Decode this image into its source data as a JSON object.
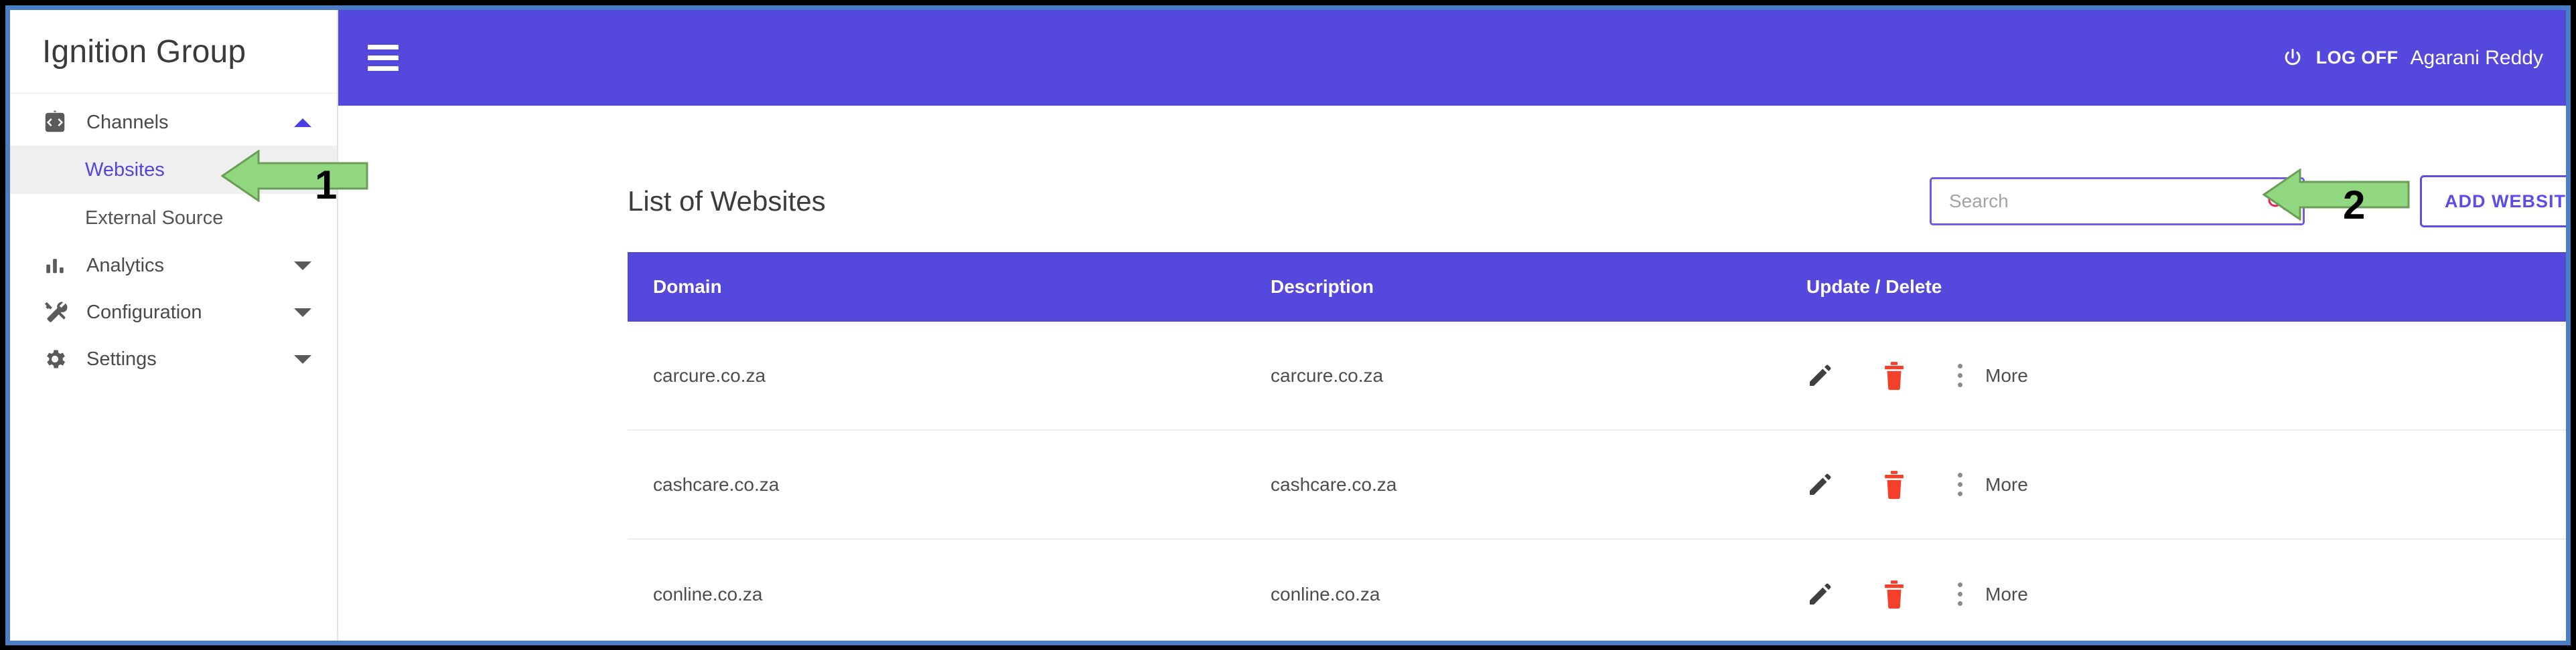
{
  "brand": {
    "title": "Ignition Group"
  },
  "sidebar": {
    "groups": [
      {
        "label": "Channels",
        "icon": "channels-icon",
        "expanded": true,
        "caret": "up"
      },
      {
        "label": "Analytics",
        "icon": "analytics-icon",
        "expanded": false,
        "caret": "down"
      },
      {
        "label": "Configuration",
        "icon": "configuration-icon",
        "expanded": false,
        "caret": "down"
      },
      {
        "label": "Settings",
        "icon": "settings-icon",
        "expanded": false,
        "caret": "down"
      }
    ],
    "channels_items": [
      {
        "label": "Websites",
        "active": true
      },
      {
        "label": "External Source",
        "active": false
      }
    ]
  },
  "topbar": {
    "menu_icon": "hamburger-icon",
    "power_icon": "power-icon",
    "logoff_label": "LOG OFF",
    "username": "Agarani Reddy",
    "background": "#5548dd"
  },
  "breadcrumb": {
    "current": "Websites"
  },
  "panel": {
    "title": "List of Websites",
    "search": {
      "value": "",
      "placeholder": "Search",
      "icon": "search-icon"
    },
    "add_button": {
      "label": "ADD WEBSITE",
      "color": "#5b4de8"
    }
  },
  "table": {
    "columns": [
      "Domain",
      "Description",
      "Update / Delete"
    ],
    "header_background": "#5548dd",
    "row_actions": {
      "edit_icon": "pencil-icon",
      "delete_icon": "trash-icon",
      "menu_icon": "kebab-menu-icon",
      "more_label": "More"
    },
    "rows": [
      {
        "domain": "carcure.co.za",
        "description": "carcure.co.za"
      },
      {
        "domain": "cashcare.co.za",
        "description": "cashcare.co.za"
      },
      {
        "domain": "conline.co.za",
        "description": "conline.co.za"
      }
    ]
  },
  "annotations": [
    {
      "number": "1",
      "target": "sidebar-item-websites",
      "color": "#90d77f"
    },
    {
      "number": "2",
      "target": "add-website-button",
      "color": "#90d77f"
    }
  ]
}
